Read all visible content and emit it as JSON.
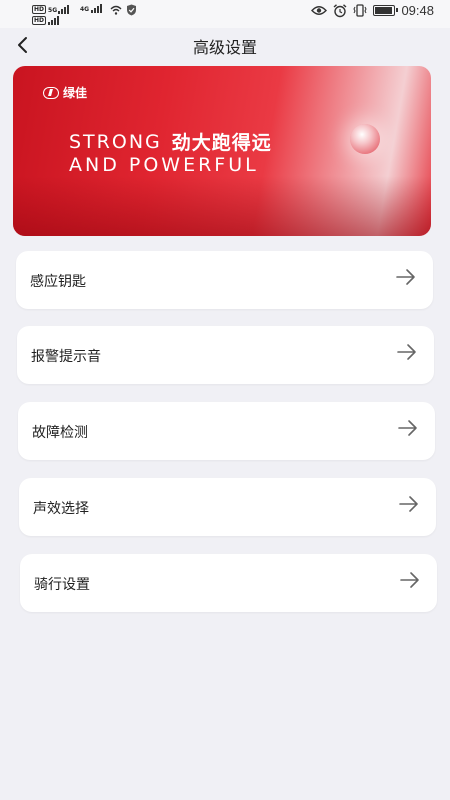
{
  "status_bar": {
    "sim1": {
      "hd": "HD",
      "network": "5G"
    },
    "sim2": {
      "hd": "HD",
      "network": "4G"
    },
    "battery_level": 1.0,
    "time": "09:48",
    "icons": [
      "hd-icon",
      "signal-icon",
      "wifi-icon",
      "shield-icon",
      "eye-icon",
      "alarm-icon",
      "vibrate-icon",
      "battery-icon"
    ]
  },
  "header": {
    "title": "高级设置",
    "back_icon": "chevron-left-icon"
  },
  "banner": {
    "brand": "绿佳",
    "line1_en": "STRONG",
    "line1_cn": "劲大跑得远",
    "line2": "AND POWERFUL",
    "colors": {
      "primary": "#d81c28",
      "highlight": "#f4cfd2"
    }
  },
  "settings": {
    "items": [
      {
        "label": "感应钥匙",
        "icon": "arrow-right-icon"
      },
      {
        "label": "报警提示音",
        "icon": "arrow-right-icon"
      },
      {
        "label": "故障检测",
        "icon": "arrow-right-icon"
      },
      {
        "label": "声效选择",
        "icon": "arrow-right-icon"
      },
      {
        "label": "骑行设置",
        "icon": "arrow-right-icon"
      }
    ]
  }
}
